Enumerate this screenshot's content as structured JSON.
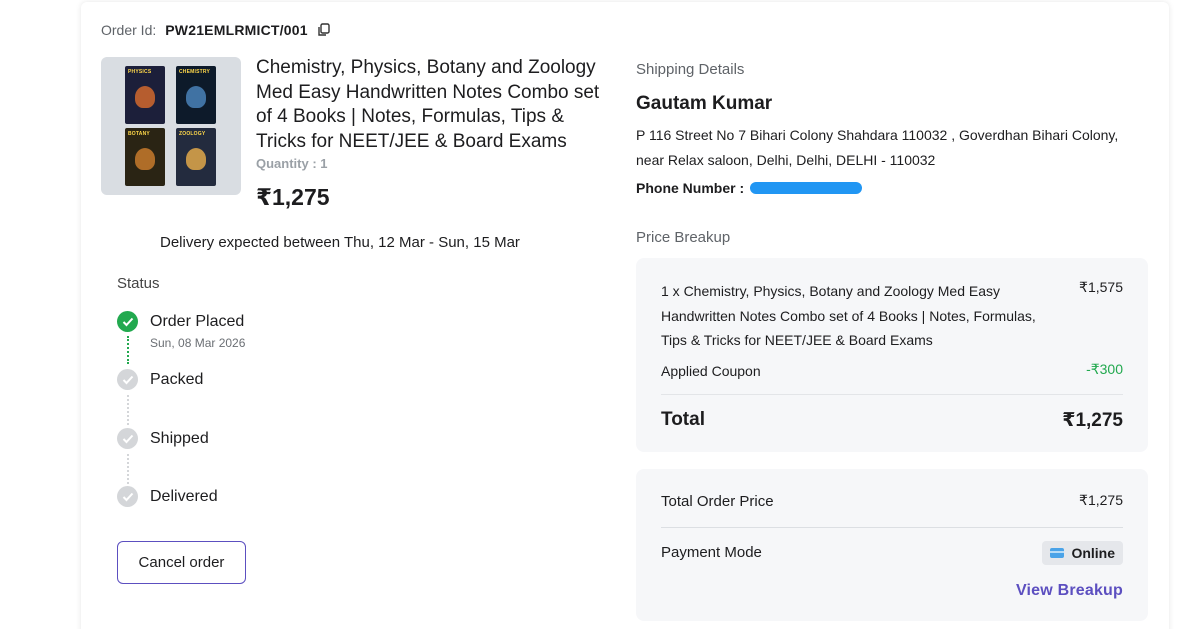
{
  "order": {
    "id_label": "Order Id:",
    "id_value": "PW21EMLRMICT/001"
  },
  "product": {
    "thumbnail_books": [
      "PHYSICS",
      "CHEMISTRY",
      "BOTANY",
      "ZOOLOGY"
    ],
    "title": "Chemistry, Physics, Botany and Zoology Med Easy Handwritten Notes Combo set of 4 Books | Notes, Formulas, Tips & Tricks for NEET/JEE & Board Exams",
    "quantity": "Quantity : 1",
    "price": "₹1,275"
  },
  "delivery": {
    "text": "Delivery expected between Thu, 12 Mar - Sun, 15 Mar"
  },
  "status": {
    "heading": "Status",
    "steps": [
      {
        "label": "Order Placed",
        "date": "Sun, 08 Mar 2026",
        "done": true
      },
      {
        "label": "Packed",
        "done": false
      },
      {
        "label": "Shipped",
        "done": false
      },
      {
        "label": "Delivered",
        "done": false
      }
    ],
    "cancel_label": "Cancel order"
  },
  "shipping": {
    "heading": "Shipping Details",
    "name": "Gautam Kumar",
    "address": "P 116 Street No 7 Bihari Colony Shahdara 110032 , Goverdhan Bihari Colony, near Relax saloon, Delhi, Delhi, DELHI - 110032",
    "phone_label": "Phone Number :"
  },
  "price_breakup": {
    "heading": "Price Breakup",
    "item_text": "1 x Chemistry, Physics, Botany and Zoology Med Easy Handwritten Notes Combo set of 4 Books | Notes, Formulas, Tips & Tricks for NEET/JEE & Board Exams",
    "item_price": "₹1,575",
    "coupon_label": "Applied Coupon",
    "coupon_value": "-₹300",
    "total_label": "Total",
    "total_value": "₹1,275"
  },
  "order_summary": {
    "total_label": "Total Order Price",
    "total_value": "₹1,275",
    "payment_label": "Payment Mode",
    "payment_value": "Online",
    "view_breakup": "View Breakup"
  },
  "colors": {
    "accent": "#5c4fc0",
    "success": "#22a94f",
    "redaction": "#2196f3"
  }
}
